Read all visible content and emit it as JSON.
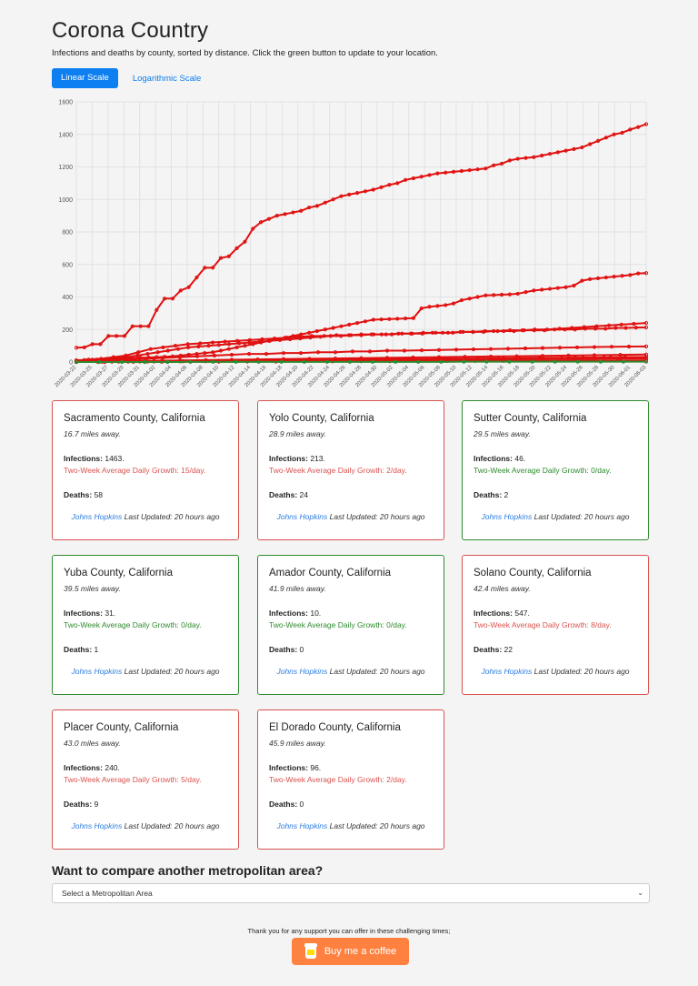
{
  "header": {
    "title": "Corona Country",
    "subtitle": "Infections and deaths by county, sorted by distance. Click the green button to update to your location."
  },
  "scale_buttons": {
    "linear": "Linear Scale",
    "log": "Logarithmic Scale"
  },
  "colors": {
    "bad": "#d9534f",
    "good": "#2e8b2e",
    "accent": "#0d7ff0",
    "line": "#e01010",
    "line_green": "#2e8b2e"
  },
  "chart_data": {
    "type": "line",
    "ylim": [
      0,
      1600
    ],
    "y_ticks": [
      "0",
      "200",
      "400",
      "600",
      "800",
      "1000",
      "1200",
      "1400",
      "1600"
    ],
    "x_tick_labels": [
      "2020-03-22",
      "2020-03-25",
      "2020-03-27",
      "2020-03-29",
      "2020-03-31",
      "2020-04-02",
      "2020-04-04",
      "2020-04-06",
      "2020-04-08",
      "2020-04-10",
      "2020-04-12",
      "2020-04-14",
      "2020-04-16",
      "2020-04-18",
      "2020-04-20",
      "2020-04-22",
      "2020-04-24",
      "2020-04-26",
      "2020-04-28",
      "2020-04-30",
      "2020-05-02",
      "2020-05-04",
      "2020-05-06",
      "2020-05-08",
      "2020-05-10",
      "2020-05-12",
      "2020-05-14",
      "2020-05-16",
      "2020-05-18",
      "2020-05-20",
      "2020-05-22",
      "2020-05-24",
      "2020-05-26",
      "2020-05-28",
      "2020-05-30",
      "2020-06-01",
      "2020-06-03"
    ],
    "series": [
      {
        "values": [
          88,
          90,
          110,
          110,
          160,
          160,
          160,
          220,
          220,
          220,
          320,
          390,
          390,
          440,
          460,
          520,
          580,
          580,
          640,
          650,
          700,
          740,
          820,
          860,
          880,
          900,
          910,
          920,
          930,
          950,
          960,
          980,
          1000,
          1020,
          1030,
          1040,
          1050,
          1060,
          1075,
          1090,
          1100,
          1120,
          1130,
          1140,
          1150,
          1160,
          1165,
          1170,
          1175,
          1180,
          1185,
          1190,
          1210,
          1220,
          1240,
          1250,
          1255,
          1260,
          1270,
          1280,
          1290,
          1300,
          1310,
          1320,
          1340,
          1360,
          1380,
          1400,
          1410,
          1430,
          1445,
          1463
        ]
      },
      {
        "values": [
          10,
          12,
          14,
          16,
          18,
          20,
          22,
          24,
          26,
          28,
          30,
          32,
          35,
          40,
          45,
          50,
          55,
          60,
          70,
          80,
          90,
          100,
          110,
          120,
          130,
          140,
          150,
          160,
          170,
          180,
          190,
          200,
          210,
          220,
          230,
          240,
          250,
          260,
          262,
          264,
          266,
          268,
          270,
          330,
          340,
          345,
          350,
          360,
          380,
          390,
          400,
          410,
          412,
          414,
          416,
          420,
          430,
          440,
          445,
          450,
          455,
          460,
          470,
          500,
          510,
          515,
          520,
          525,
          530,
          535,
          545,
          547
        ]
      },
      {
        "values": [
          5,
          10,
          15,
          20,
          25,
          30,
          40,
          50,
          60,
          70,
          80,
          90,
          95,
          100,
          105,
          110,
          115,
          120,
          125,
          130,
          135,
          140,
          145,
          150,
          155,
          160,
          160,
          165,
          165,
          170,
          170,
          170,
          175,
          175,
          175,
          180,
          180,
          180,
          185,
          185,
          185,
          190,
          190,
          190,
          195,
          195,
          195,
          200,
          200,
          200,
          205,
          205,
          205,
          210,
          210,
          212,
          213
        ]
      },
      {
        "values": [
          10,
          15,
          20,
          30,
          40,
          60,
          80,
          90,
          100,
          110,
          115,
          120,
          125,
          130,
          135,
          140,
          145,
          150,
          155,
          160,
          160,
          165,
          165,
          170,
          170,
          170,
          175,
          175,
          180,
          180,
          180,
          185,
          185,
          190,
          190,
          195,
          195,
          200,
          200,
          205,
          210,
          215,
          220,
          225,
          230,
          235,
          240
        ]
      },
      {
        "values": [
          5,
          8,
          10,
          15,
          20,
          25,
          30,
          35,
          40,
          45,
          50,
          50,
          55,
          55,
          60,
          60,
          65,
          65,
          70,
          70,
          72,
          74,
          76,
          78,
          80,
          82,
          84,
          86,
          88,
          90,
          92,
          94,
          95,
          96
        ]
      },
      {
        "values": [
          2,
          4,
          6,
          8,
          10,
          12,
          14,
          16,
          18,
          20,
          22,
          24,
          26,
          28,
          30,
          32,
          34,
          36,
          38,
          40,
          42,
          44,
          46
        ]
      },
      {
        "values": [
          1,
          2,
          3,
          5,
          7,
          9,
          11,
          13,
          15,
          17,
          19,
          21,
          23,
          25,
          27,
          29,
          31
        ]
      },
      {
        "values": [
          0,
          1,
          2,
          3,
          4,
          5,
          6,
          7,
          8,
          9,
          10,
          11,
          12,
          13,
          14,
          15,
          16,
          17,
          18,
          19,
          20,
          21,
          22,
          24,
          26,
          28,
          30,
          31
        ]
      },
      {
        "values": [
          0,
          0,
          1,
          1,
          2,
          2,
          3,
          3,
          4,
          4,
          5,
          5,
          6,
          6,
          7,
          7,
          8,
          8,
          9,
          9,
          10
        ]
      },
      {
        "values": [
          0,
          1,
          2,
          3,
          4,
          5,
          6,
          7,
          8,
          9,
          10,
          11,
          12,
          13,
          14,
          15,
          16,
          17,
          18,
          19,
          20,
          21,
          22
        ]
      }
    ],
    "green_series": [
      0,
      0,
      0,
      0,
      0,
      1,
      1,
      1,
      1,
      1,
      1,
      1,
      1,
      1,
      1,
      1,
      1,
      2,
      2,
      2,
      2,
      2,
      2,
      2,
      2,
      2
    ]
  },
  "cards": [
    {
      "name": "Sacramento County, California",
      "distance": "16.7 miles away.",
      "infections_label": "Infections:",
      "infections": " 1463.",
      "growth": "Two-Week Average Daily Growth: 15/day.",
      "deaths_label": "Deaths:",
      "deaths": " 58",
      "source": "Johns Hopkins",
      "updated": "Last Updated: 20 hours ago",
      "status": "bad"
    },
    {
      "name": "Yolo County, California",
      "distance": "28.9 miles away.",
      "infections_label": "Infections:",
      "infections": " 213.",
      "growth": "Two-Week Average Daily Growth: 2/day.",
      "deaths_label": "Deaths:",
      "deaths": " 24",
      "source": "Johns Hopkins",
      "updated": "Last Updated: 20 hours ago",
      "status": "bad"
    },
    {
      "name": "Sutter County, California",
      "distance": "29.5 miles away.",
      "infections_label": "Infections:",
      "infections": " 46.",
      "growth": "Two-Week Average Daily Growth: 0/day.",
      "deaths_label": "Deaths:",
      "deaths": " 2",
      "source": "Johns Hopkins",
      "updated": "Last Updated: 20 hours ago",
      "status": "good"
    },
    {
      "name": "Yuba County, California",
      "distance": "39.5 miles away.",
      "infections_label": "Infections:",
      "infections": " 31.",
      "growth": "Two-Week Average Daily Growth: 0/day.",
      "deaths_label": "Deaths:",
      "deaths": " 1",
      "source": "Johns Hopkins",
      "updated": "Last Updated: 20 hours ago",
      "status": "good"
    },
    {
      "name": "Amador County, California",
      "distance": "41.9 miles away.",
      "infections_label": "Infections:",
      "infections": " 10.",
      "growth": "Two-Week Average Daily Growth: 0/day.",
      "deaths_label": "Deaths:",
      "deaths": " 0",
      "source": "Johns Hopkins",
      "updated": "Last Updated: 20 hours ago",
      "status": "good"
    },
    {
      "name": "Solano County, California",
      "distance": "42.4 miles away.",
      "infections_label": "Infections:",
      "infections": " 547.",
      "growth": "Two-Week Average Daily Growth: 8/day.",
      "deaths_label": "Deaths:",
      "deaths": " 22",
      "source": "Johns Hopkins",
      "updated": "Last Updated: 20 hours ago",
      "status": "bad"
    },
    {
      "name": "Placer County, California",
      "distance": "43.0 miles away.",
      "infections_label": "Infections:",
      "infections": " 240.",
      "growth": "Two-Week Average Daily Growth: 5/day.",
      "deaths_label": "Deaths:",
      "deaths": " 9",
      "source": "Johns Hopkins",
      "updated": "Last Updated: 20 hours ago",
      "status": "bad"
    },
    {
      "name": "El Dorado County, California",
      "distance": "45.9 miles away.",
      "infections_label": "Infections:",
      "infections": " 96.",
      "growth": "Two-Week Average Daily Growth: 2/day.",
      "deaths_label": "Deaths:",
      "deaths": " 0",
      "source": "Johns Hopkins",
      "updated": "Last Updated: 20 hours ago",
      "status": "bad"
    }
  ],
  "compare": {
    "heading": "Want to compare another metropolitan area?",
    "select_value": "Select a Metropolitan Area"
  },
  "footer": {
    "thanks": "Thank you for any support you can offer in these challenging times;",
    "coffee_label": "Buy me a coffee"
  }
}
